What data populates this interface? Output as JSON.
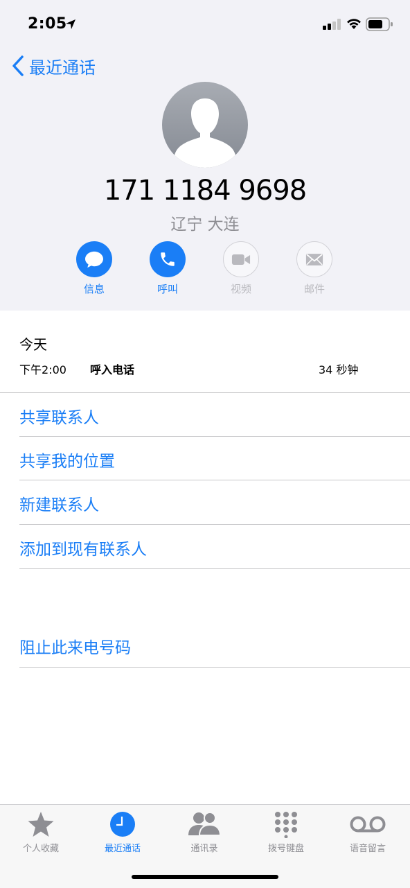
{
  "status_bar": {
    "time": "2:05"
  },
  "nav": {
    "back_label": "最近通话"
  },
  "contact": {
    "phone_number": "171 1184 9698",
    "location": "辽宁 大连"
  },
  "actions": [
    {
      "label": "信息",
      "enabled": true
    },
    {
      "label": "呼叫",
      "enabled": true
    },
    {
      "label": "视频",
      "enabled": false
    },
    {
      "label": "邮件",
      "enabled": false
    }
  ],
  "call_log": {
    "day": "今天",
    "time": "下午2:00",
    "type": "呼入电话",
    "duration": "34 秒钟"
  },
  "menu": {
    "share_contact": "共享联系人",
    "share_location": "共享我的位置",
    "new_contact": "新建联系人",
    "add_existing": "添加到现有联系人",
    "block": "阻止此来电号码"
  },
  "tabs": [
    {
      "label": "个人收藏",
      "active": false
    },
    {
      "label": "最近通话",
      "active": true
    },
    {
      "label": "通讯录",
      "active": false
    },
    {
      "label": "拨号键盘",
      "active": false
    },
    {
      "label": "语音留言",
      "active": false
    }
  ],
  "colors": {
    "accent": "#1a7ef6",
    "header_bg": "#f2f2f7",
    "secondary_text": "#8e8e93",
    "disabled": "#b9b9be"
  }
}
